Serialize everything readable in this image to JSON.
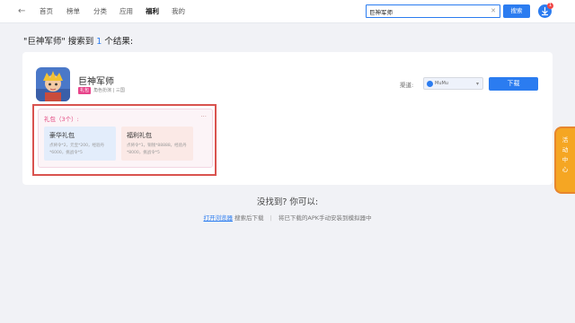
{
  "nav": {
    "back_glyph": "←",
    "items": [
      "首页",
      "榜单",
      "分类",
      "应用",
      "福利",
      "我的"
    ],
    "active": "福利"
  },
  "search": {
    "value": "巨神军师",
    "button_label": "搜索",
    "clear_glyph": "✕"
  },
  "download_manager": {
    "badge_count": "1"
  },
  "result": {
    "prefix": "\"巨神军师\" 搜索到 ",
    "count": "1",
    "suffix": " 个结果:"
  },
  "app": {
    "name": "巨神军师",
    "tag": "礼包",
    "meta": "角色扮演 | 三国",
    "channel_label": "渠道:",
    "channel_value": "MuMu",
    "download_label": "下载"
  },
  "gifts": {
    "title": "礼包（3个）:",
    "more": "...",
    "items": [
      {
        "name": "豪华礼包",
        "desc": "点将令*2，元宝*200，经验丹*6000，挑战令*5"
      },
      {
        "name": "福利礼包",
        "desc": "点将令*1，铜钱*88888，经验丹*8000，挑战令*5"
      }
    ]
  },
  "side_badge": {
    "text": "活动中心"
  },
  "footer": {
    "not_found": "没找到? 你可以:",
    "open_browser": "打开浏览器",
    "after_search": "搜索后下载",
    "install_text": "将已下载的APK手动安装到模拟器中"
  },
  "colors": {
    "accent": "#2b7cf0",
    "gift_pink": "#e2457f",
    "highlight_red": "#d9534f",
    "badge_orange": "#f5a623"
  }
}
